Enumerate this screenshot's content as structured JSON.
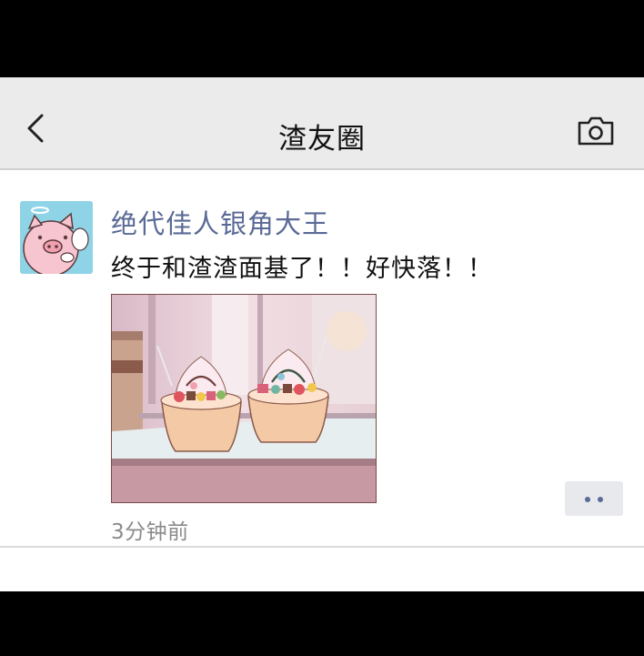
{
  "navbar": {
    "title": "渣友圈",
    "back_icon": "chevron-left-icon",
    "camera_icon": "camera-icon"
  },
  "post": {
    "author": "绝代佳人银角大王",
    "text": "终于和渣渣面基了！！好快落！！",
    "timestamp": "3分钟前",
    "image_description_icon": "ice-cream-photo",
    "more_icon": "more-dots-icon"
  },
  "colors": {
    "navbar_bg": "#ebebeb",
    "author_name": "#5a6a96",
    "timestamp": "#8a8a8a",
    "more_button_bg": "#e8e9ed",
    "avatar_bg": "#8fd3e7"
  }
}
